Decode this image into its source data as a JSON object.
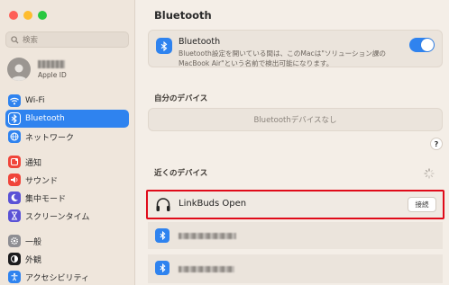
{
  "sidebar": {
    "search_placeholder": "検索",
    "profile": {
      "subtitle": "Apple ID"
    },
    "group1": [
      {
        "label": "Wi-Fi",
        "icon": "wifi-icon",
        "color": "#2f83ef"
      },
      {
        "label": "Bluetooth",
        "icon": "bluetooth-icon",
        "color": "#2f83ef",
        "active": true
      },
      {
        "label": "ネットワーク",
        "icon": "globe-icon",
        "color": "#2f83ef"
      }
    ],
    "group2": [
      {
        "label": "通知",
        "icon": "bell-icon",
        "color": "#f0453a"
      },
      {
        "label": "サウンド",
        "icon": "speaker-icon",
        "color": "#f0453a"
      },
      {
        "label": "集中モード",
        "icon": "moon-icon",
        "color": "#5a52d6"
      },
      {
        "label": "スクリーンタイム",
        "icon": "hourglass-icon",
        "color": "#5a52d6"
      }
    ],
    "group3": [
      {
        "label": "一般",
        "icon": "gear-icon",
        "color": "#8e8e93"
      },
      {
        "label": "外観",
        "icon": "appearance-icon",
        "color": "#1c1c1e"
      },
      {
        "label": "アクセシビリティ",
        "icon": "accessibility-icon",
        "color": "#2f83ef"
      }
    ]
  },
  "main": {
    "title": "Bluetooth",
    "bluetooth_card": {
      "label": "Bluetooth",
      "description": "Bluetooth設定を開いている間は、このMacは\"ソリューション課のMacBook Air\"という名前で検出可能になります。",
      "enabled": true
    },
    "my_devices": {
      "title": "自分のデバイス",
      "empty_text": "Bluetoothデバイスなし"
    },
    "help_label": "?",
    "nearby": {
      "title": "近くのデバイス",
      "devices": [
        {
          "name": "LinkBuds Open",
          "icon": "headphones-icon",
          "button": "接続",
          "highlighted": true
        }
      ]
    }
  },
  "colors": {
    "accent": "#2f83ef",
    "highlight": "#e00b1a"
  }
}
